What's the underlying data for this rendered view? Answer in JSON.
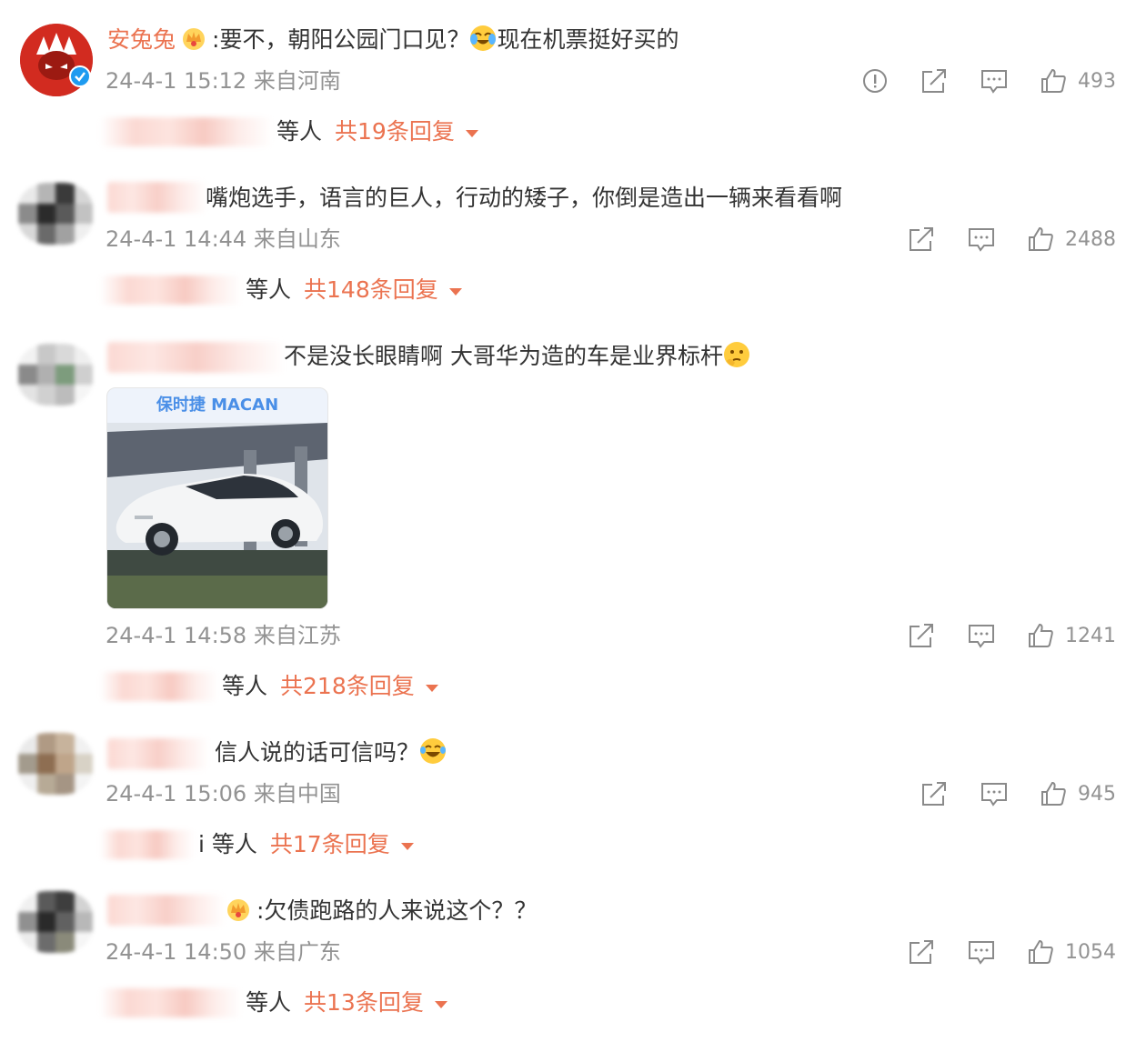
{
  "colors": {
    "accent": "#eb7350",
    "meta": "#939393",
    "text": "#333333",
    "verified": "#1e9bf0"
  },
  "comments": [
    {
      "username": "安兔兔",
      "has_crown": true,
      "verified": true,
      "text": ":要不，朝阳公园门口见？",
      "emoji_after": "cry-laugh-emoji",
      "text2": "现在机票挺好买的",
      "timestamp": "24-4-1 15:12 来自河南",
      "has_report": true,
      "likes": "493",
      "reply_prefix": "等人",
      "reply_count": "共19条回复"
    },
    {
      "text": "嘴炮选手，语言的巨人，行动的矮子，你倒是造出一辆来看看啊",
      "timestamp": "24-4-1 14:44 来自山东",
      "likes": "2488",
      "reply_prefix": "等人",
      "reply_count": "共148条回复"
    },
    {
      "text": "不是没长眼睛啊 大哥华为造的车是业界标杆",
      "emoji_after": "thinking-emoji",
      "image_title": "保时捷 MACAN",
      "timestamp": "24-4-1 14:58 来自江苏",
      "likes": "1241",
      "reply_prefix": "等人",
      "reply_count": "共218条回复"
    },
    {
      "text": "信人说的话可信吗？",
      "emoji_after": "laugh-emoji",
      "timestamp": "24-4-1 15:06 来自中国",
      "likes": "945",
      "reply_prefix": "i 等人",
      "reply_count": "共17条回复"
    },
    {
      "has_crown": true,
      "text": ":欠债跑路的人来说这个？？",
      "timestamp": "24-4-1 14:50 来自广东",
      "likes": "1054",
      "reply_prefix": "等人",
      "reply_count": "共13条回复"
    }
  ]
}
